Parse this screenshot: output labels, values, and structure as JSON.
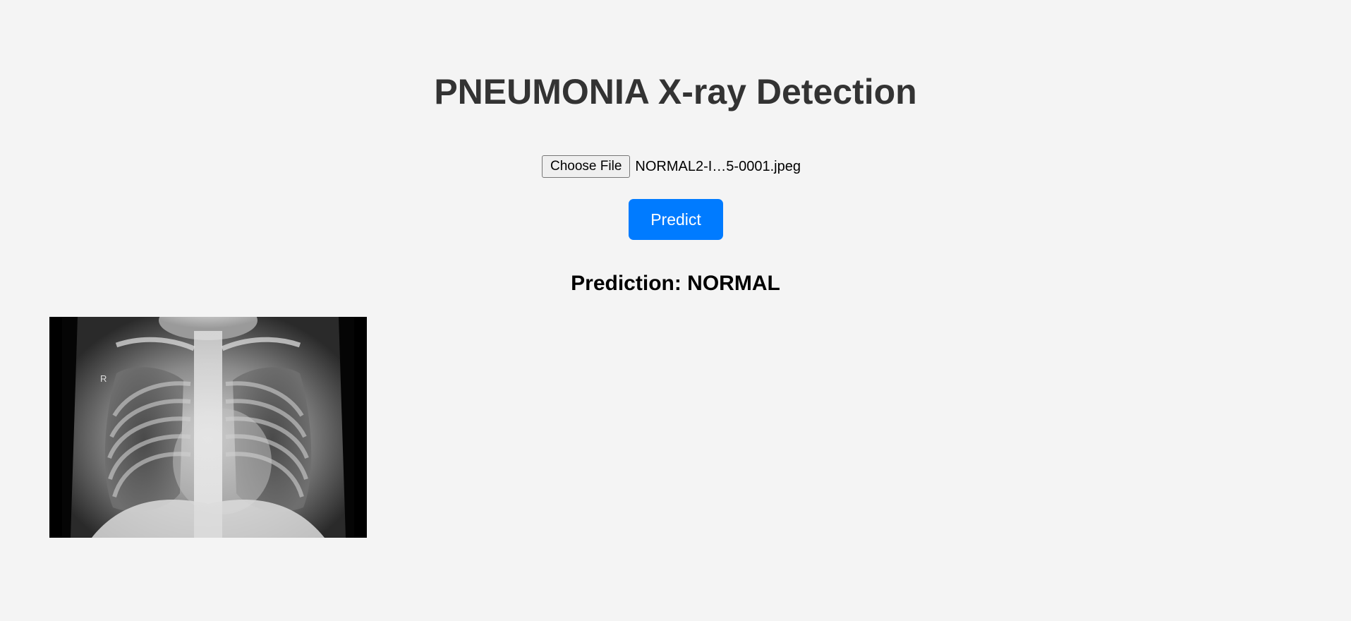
{
  "page": {
    "title": "PNEUMONIA X-ray Detection"
  },
  "upload": {
    "choose_file_label": "Choose File",
    "file_name": "NORMAL2-I…5-0001.jpeg"
  },
  "predict_button": {
    "label": "Predict",
    "color": "#007bff"
  },
  "result": {
    "prediction_text": "Prediction: NORMAL"
  },
  "image": {
    "alt": "chest x-ray",
    "marker_letter": "R"
  }
}
